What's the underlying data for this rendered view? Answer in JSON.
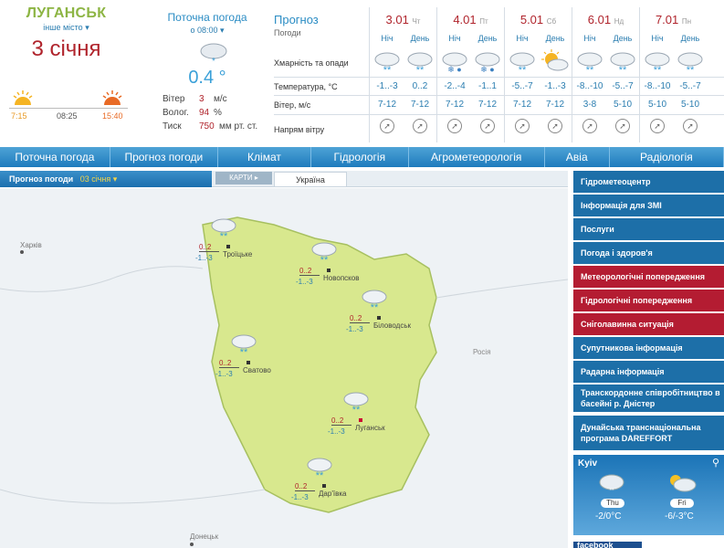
{
  "city": {
    "name": "ЛУГАНСЬК",
    "other": "інше місто",
    "date": "3 січня",
    "sunrise": "7:15",
    "daylen": "08:25",
    "sunset": "15:40"
  },
  "current": {
    "title": "Поточна погода",
    "time": "о 08:00",
    "temp": "0.4 °",
    "wind_label": "Вітер",
    "wind": "3",
    "wind_unit": "м/с",
    "hum_label": "Волог.",
    "hum": "94",
    "hum_unit": "%",
    "press_label": "Тиск",
    "press": "750",
    "press_unit": "мм рт. ст."
  },
  "forecast": {
    "title": "Прогноз",
    "subtitle": "Погоди",
    "row_labels": [
      "Хмарність та опади",
      "Температура, °С",
      "Вітер, м/с",
      "Напрям вітру"
    ],
    "night": "Ніч",
    "day": "День",
    "days": [
      {
        "date": "3.01",
        "dow": "Чт",
        "temp": [
          "-1..-3",
          "0..2"
        ],
        "wind": [
          "7-12",
          "7-12"
        ],
        "icons": [
          "cloud-snow-icon",
          "cloud-snow-icon"
        ]
      },
      {
        "date": "4.01",
        "dow": "Пт",
        "temp": [
          "-2..-4",
          "-1..1"
        ],
        "wind": [
          "7-12",
          "7-12"
        ],
        "icons": [
          "cloud-sleet-icon",
          "cloud-sleet-icon"
        ]
      },
      {
        "date": "5.01",
        "dow": "Сб",
        "temp": [
          "-5..-7",
          "-1..-3"
        ],
        "wind": [
          "7-12",
          "7-12"
        ],
        "icons": [
          "cloud-snow-icon",
          "sun-cloud-icon"
        ]
      },
      {
        "date": "6.01",
        "dow": "Нд",
        "temp": [
          "-8..-10",
          "-5..-7"
        ],
        "wind": [
          "3-8",
          "5-10"
        ],
        "icons": [
          "cloud-snow-icon",
          "cloud-snow-icon"
        ]
      },
      {
        "date": "7.01",
        "dow": "Пн",
        "temp": [
          "-8..-10",
          "-5..-7"
        ],
        "wind": [
          "5-10",
          "5-10"
        ],
        "icons": [
          "cloud-snow-icon",
          "cloud-snow-icon"
        ]
      }
    ]
  },
  "nav": [
    "Поточна погода",
    "Прогноз погоди",
    "Клімат",
    "Гідрологія",
    "Агрометеорологія",
    "Авіа",
    "Радіологія"
  ],
  "map": {
    "tab": "Прогноз погоди",
    "date": "03 січня",
    "maps_btn": "КАРТИ",
    "region": "Україна",
    "labels": {
      "kharkiv": "Харків",
      "russia": "Росія",
      "donetsk": "Донецьк"
    },
    "cities": [
      {
        "name": "Троїцьке",
        "day": "0..2",
        "night": "-1..-3"
      },
      {
        "name": "Новопсков",
        "day": "0..2",
        "night": "-1..-3"
      },
      {
        "name": "Біловодськ",
        "day": "0..2",
        "night": "-1..-3"
      },
      {
        "name": "Сватово",
        "day": "0..2",
        "night": "-1..-3"
      },
      {
        "name": "Луганськ",
        "day": "0..2",
        "night": "-1..-3"
      },
      {
        "name": "Дар'ївка",
        "day": "0..2",
        "night": "-1..-3"
      }
    ]
  },
  "menu": [
    {
      "label": "Гідрометеоцентр",
      "color": "blue"
    },
    {
      "label": "Інформація для ЗМІ",
      "color": "blue"
    },
    {
      "label": "Послуги",
      "color": "blue"
    },
    {
      "label": "Погода і здоров'я",
      "color": "blue"
    },
    {
      "label": "Метеорологічні попередження",
      "color": "red"
    },
    {
      "label": "Гідрологічні попередження",
      "color": "red"
    },
    {
      "label": "Сніголавинна ситуація",
      "color": "red"
    },
    {
      "label": "Супутникова інформація",
      "color": "blue"
    },
    {
      "label": "Радарна інформація",
      "color": "blue"
    },
    {
      "label": "Транскордонне співробітництво в басейні р. Дністер",
      "color": "blue"
    },
    {
      "label": "Дунайська транснаціональна програма DAREFFORT",
      "color": "blue"
    }
  ],
  "widget": {
    "city": "Kyiv",
    "d1": "Thu",
    "t1": "-2/0°C",
    "d2": "Fri",
    "t2": "-6/-3°C"
  },
  "facebook": "facebook"
}
